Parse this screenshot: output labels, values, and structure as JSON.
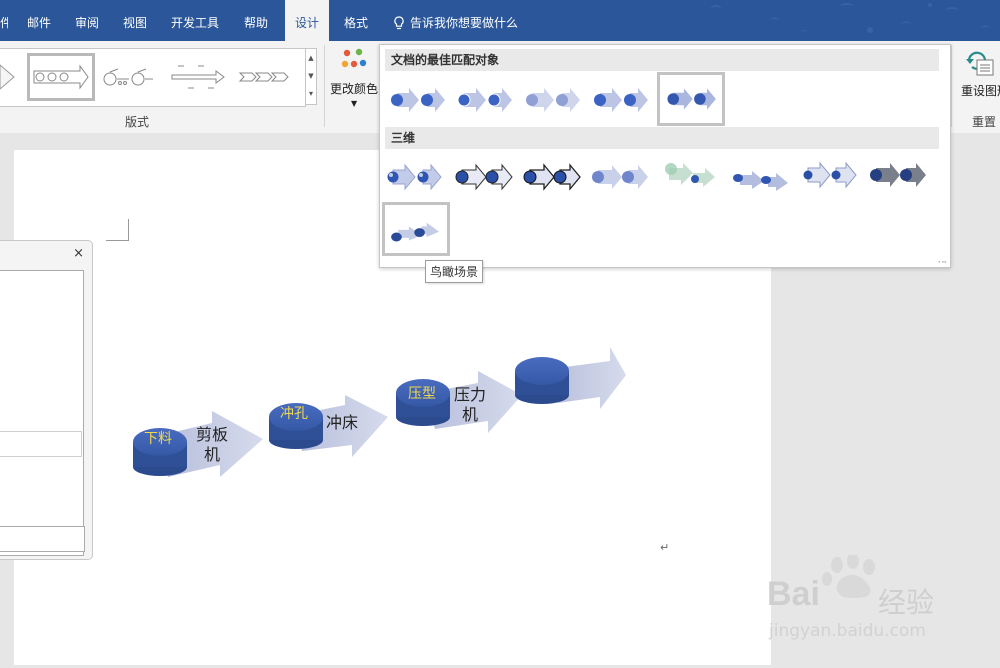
{
  "tabs": [
    {
      "label": "邮件"
    },
    {
      "label": "审阅"
    },
    {
      "label": "视图"
    },
    {
      "label": "开发工具"
    },
    {
      "label": "帮助"
    },
    {
      "label": "设计"
    },
    {
      "label": "格式"
    }
  ],
  "tell_me": "告诉我你想要做什么",
  "ribbon": {
    "layouts_group_label": "版式",
    "change_colors_label": "更改颜色",
    "reset_graphic_label": "重设图形",
    "reset_group_label": "重置"
  },
  "styles_dropdown": {
    "section_best_match": "文档的最佳匹配对象",
    "section_3d": "三维",
    "tooltip": "鸟瞰场景"
  },
  "smartart": {
    "nodes": [
      {
        "disc_text": "下料",
        "arrow_text_line1": "剪板",
        "arrow_text_line2": "机"
      },
      {
        "disc_text": "冲孔",
        "arrow_text_line1": "冲床",
        "arrow_text_line2": ""
      },
      {
        "disc_text": "压型",
        "arrow_text_line1": "压力",
        "arrow_text_line2": "机"
      },
      {
        "disc_text": "",
        "arrow_text_line1": "",
        "arrow_text_line2": ""
      }
    ]
  },
  "document": {
    "paragraph_mark": "↵"
  },
  "text_pane": {
    "close": "×"
  },
  "watermark": {
    "brand": "Bai",
    "brand2": "经验",
    "url": "jingyan.baidu.com"
  },
  "colors": {
    "accent": "#2b579a",
    "disc": "#3d5fae",
    "arrow": "#c3c9e0"
  }
}
